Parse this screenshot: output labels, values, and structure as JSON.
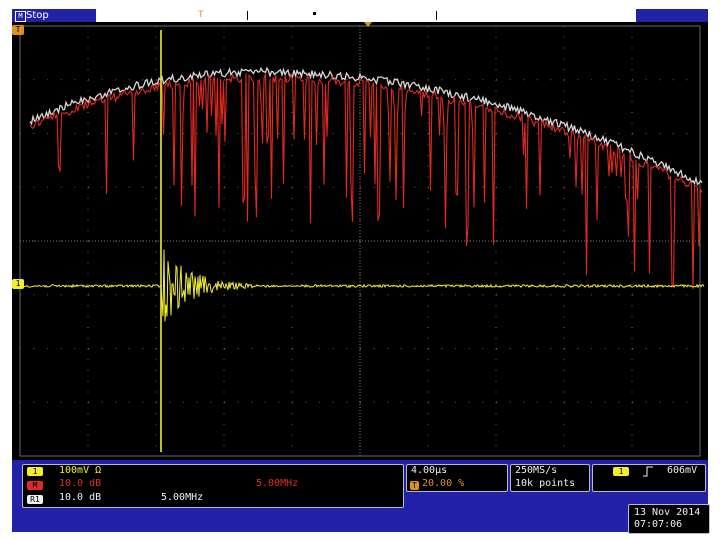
{
  "header": {
    "channel_chip": "M",
    "trigger_mode": "Stop",
    "trigger_position_icon": "trigger-position-icon",
    "trigger_marker": "T"
  },
  "markers": {
    "trace_top_marker": "T",
    "ch1_level_marker": "1"
  },
  "channel1": {
    "chip": "1",
    "scale": "100mV",
    "coupling": "Ω",
    "color": "#f2ee2e"
  },
  "math": {
    "chip": "M",
    "scale": "10.0 dB",
    "span": "5.00MHz",
    "color": "#e02a20"
  },
  "ref1": {
    "chip": "R1",
    "scale": "10.0 dB",
    "span": "5.00MHz",
    "color": "#f0f0f0"
  },
  "timebase": {
    "horizontal": "4.00µs",
    "trigger_chip": "T",
    "trigger_pos": "20.00 %"
  },
  "acquisition": {
    "sample_rate": "250MS/s",
    "record_length": "10k points"
  },
  "trigger": {
    "source_chip": "1",
    "slope_icon": "rising-edge-icon",
    "level": "606mV"
  },
  "datetime": {
    "date": "13 Nov 2014",
    "time": "07:07:06"
  }
}
